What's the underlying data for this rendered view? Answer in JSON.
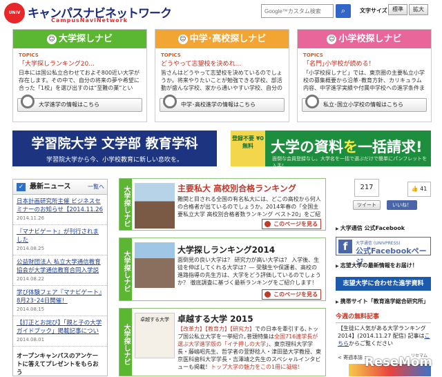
{
  "header": {
    "logo_mark": "UNIV PRESS",
    "logo_title": "キャンパスナビネットワーク",
    "logo_subtitle": "CampusNaviNetwork",
    "search_placeholder": "Google™カスタム検索",
    "search_icon": "search-icon",
    "font_size_label": "文字サイズ",
    "font_standard": "標準",
    "font_large": "拡大"
  },
  "panels": [
    {
      "title": "大学探しナビ",
      "color": "#5bb632",
      "topics_label": "TOPICS",
      "topic_title": "「大学探しランキング20…",
      "body": "日本には国公私立合わせておよそ800近い大学が存在します。その中で、自分の将来の夢や希望に合った「1校」を選び出すのは“至難の業”といっ…",
      "link": "大学進学の情報はこちら"
    },
    {
      "title": "中学･高校探しナビ",
      "color": "#f2a532",
      "topics_label": "TOPICS",
      "topic_title": "どうやって志望校を決めれ…",
      "body": "皆さんはどうやって志望校を決めているのでしょうか。将来やりたいことが勉強できる学校、部活動が盛んな学校、家から通いやすい学校、自分の成績に…",
      "link": "中学･高校進学の情報はこちら"
    },
    {
      "title": "小学校探しナビ",
      "color": "#e8669a",
      "topics_label": "TOPICS",
      "topic_title": "「名門｣小学校が読める！",
      "body": "「小学校探しナビ」では、東京圏の主要私立小学校の募集概要から沿革･教育方針、カリキュラム内容、中学進学実績や付属中学校への進学条件まで、小学…",
      "link": "私立･国立小学校の情報はこちら"
    }
  ],
  "banners": {
    "gakushuin_title": "学習院大学 文学部 教育学科",
    "gakushuin_sub": "学習院大学から今、小学校教育に新しい息吹を。",
    "request_left": "登録不要 ¥0 無料",
    "request_title_a": "大学の資料",
    "request_title_b": "を",
    "request_title_c": "一括請求!",
    "request_sub": "面倒な会員登録なし。大学名を一括で選ぶだけで簡単にパンフレットを入手!"
  },
  "news": {
    "heading": "最新ニュース",
    "more": "一覧へ",
    "items": [
      {
        "title": "日本計画研究所主催 ビジネスセミナーのお知らせ【2014.11.26更新】",
        "date": "2014.11.26"
      },
      {
        "title": "『マナビゲート』が刊行されました",
        "date": "2014.08.25"
      },
      {
        "title": "公益財団法人 私立大学通信教育協会が大学通信教育合同入学説明会を実施",
        "date": "2014.08.22"
      },
      {
        "title": "学び体験フェア『マナビゲート』8月23･24日開催！",
        "date": "2014.08.15"
      },
      {
        "title": "【訂正とお詫び】「親と子の大学ガイドブック」掲載記事について",
        "date": "2014.08.01"
      }
    ],
    "last": "オープンキャンパスのアンケートに答えてプレゼントをもらおう"
  },
  "features": [
    {
      "tab": "大学探しナビ",
      "title": "主要私大 高校別合格ランキング",
      "text": "難関と目される全国の有名私大には、どこの高校から何人の合格者が出ているのでしょうか。2014年春の「全国主要私立大学 高校別合格者数ランキング ベスト20」をご紹介します!",
      "button": "このページを見る"
    },
    {
      "tab": "大学探しナビ",
      "title": "大学探しランキング2014",
      "text": "面倒見の良い大学は？ 研究力が高い大学は？ 入学後、生徒を伸ばしてくれる大学は？― 受験生や保護者、高校の進路指導の先生方は、大学をどう評価しているのでしょうか？ 徹底調査に基づく最新ランキングをご紹介します！",
      "button": "このページを見る"
    },
    {
      "tab": "大学探しナビ",
      "title": "卓越する大学 2015",
      "image_text": "卓越する大学",
      "text_red": "【改革力】【教育力】【研究力】",
      "text": "での日本を牽引する､トップ国公私立大学を一挙紹介｡巻頭特集は",
      "text_red2": "全国716連学長が選ぶ大学進学版の「イチ押しの大学」",
      "text2": "、東京理科大学学長・藤嶋昭先生、哲学者の萱野稔人・津田塾大学教授、東京医科歯科大学学長・吉澤靖之先生のスペシャルインタビューも掲載！",
      "text_red3": "トップ大学の魅力をこの1冊に凝縮！"
    }
  ],
  "social": {
    "share_count": "217",
    "tweet": "ツイート",
    "like_count": "41",
    "like": "いいね！"
  },
  "right": {
    "fb_label": "大学通信 公式Facebook",
    "fb_small": "大学通信 (UNIVPRESS)",
    "fb_big": "公式Facebookページ",
    "news_label": "志望大学の最新情報をお届け！",
    "fit_banner": "志望大学に合わせた進学資料",
    "research_label": "携帯サイト「教育進学総合研究所」",
    "free_heading": "今週の無料記事",
    "free_body": "【生徒に人気がある大学ランキング2014】(2014.11.27 配信) 記事は",
    "free_link": "こちら",
    "free_body_end": "からご覧ください",
    "free_sub": "< 寄週本誌 >",
    "watermark": "ReseMom",
    "watermark_sub": "リセマム"
  }
}
